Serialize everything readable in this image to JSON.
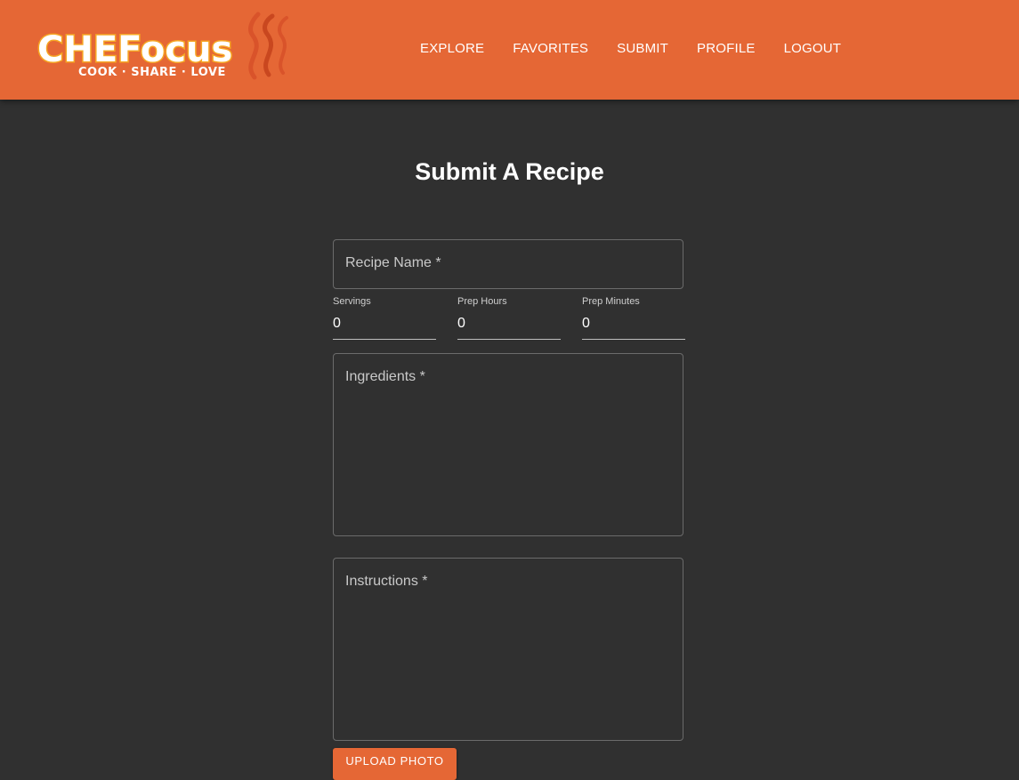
{
  "brand": {
    "name": "CHEFocus",
    "tagline": "COOK · SHARE · LOVE",
    "colors": {
      "primary": "#e56735",
      "background": "#303030",
      "logo_text": "#ffffff",
      "logo_outline": "#f6a623"
    }
  },
  "nav": {
    "items": [
      {
        "label": "EXPLORE"
      },
      {
        "label": "FAVORITES"
      },
      {
        "label": "SUBMIT"
      },
      {
        "label": "PROFILE"
      },
      {
        "label": "LOGOUT"
      }
    ]
  },
  "page": {
    "title": "Submit A Recipe"
  },
  "form": {
    "recipe_name": {
      "label": "Recipe Name *",
      "value": ""
    },
    "servings": {
      "label": "Servings",
      "value": "0"
    },
    "prep_hours": {
      "label": "Prep Hours",
      "value": "0"
    },
    "prep_minutes": {
      "label": "Prep Minutes",
      "value": "0"
    },
    "ingredients": {
      "label": "Ingredients *",
      "value": ""
    },
    "instructions": {
      "label": "Instructions *",
      "value": ""
    },
    "upload_button": {
      "label": "UPLOAD PHOTO"
    }
  },
  "icons": {
    "logo_flame": "steam-flame-icon"
  }
}
